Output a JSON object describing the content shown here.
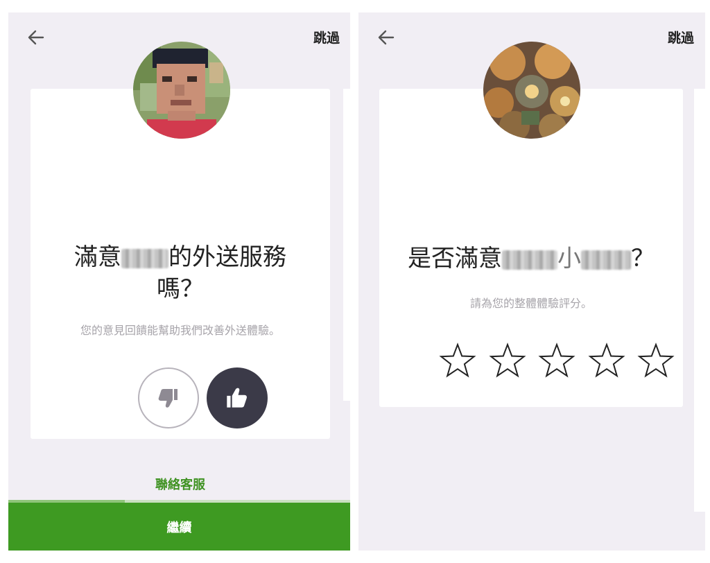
{
  "left_screen": {
    "skip_label": "跳過",
    "headline_prefix": "滿意",
    "headline_suffix": "的外送服務",
    "headline_line2": "嗎？",
    "subtitle": "您的意見回饋能幫助我們改善外送體驗。",
    "contact_label": "聯絡客服",
    "continue_label": "繼續",
    "progress": 0.34,
    "icons": [
      "back-arrow-icon",
      "thumbs-down-icon",
      "thumbs-up-icon"
    ]
  },
  "right_screen": {
    "skip_label": "跳過",
    "headline_prefix": "是否滿意",
    "headline_middle": "小",
    "headline_suffix": "？",
    "subtitle": "請為您的整體體驗評分。",
    "star_count": 5,
    "icons": [
      "back-arrow-icon",
      "star-icon"
    ]
  },
  "colors": {
    "background": "#f1eef4",
    "accent_green": "#3e9a22",
    "link_green": "#3f9222",
    "dark_button": "#3b3a48"
  }
}
